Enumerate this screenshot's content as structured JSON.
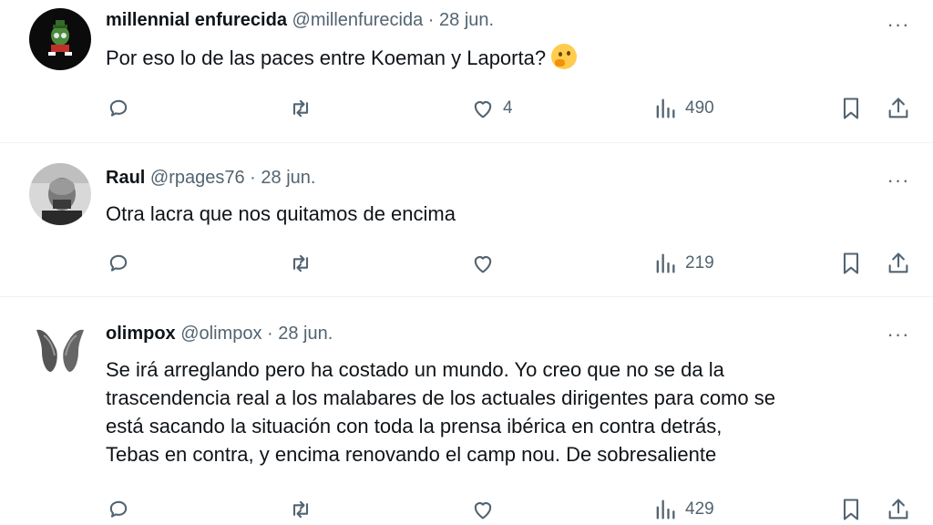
{
  "tweets": [
    {
      "name": "millennial enfurecida",
      "handle": "@millenfurecida",
      "separator": "·",
      "date": "28 jun.",
      "text": "Por eso lo de las paces entre Koeman y Laporta?",
      "emoji": "thinking-face",
      "likes": "4",
      "views": "490"
    },
    {
      "name": "Raul",
      "handle": "@rpages76",
      "separator": "·",
      "date": "28 jun.",
      "text": "Otra lacra que nos quitamos de encima",
      "likes": "",
      "views": "219"
    },
    {
      "name": "olimpox",
      "handle": "@olimpox",
      "separator": "·",
      "date": "28 jun.",
      "text_lines": [
        "Se irá arreglando pero ha costado un mundo. Yo creo que no se da la",
        "trascendencia real a los malabares de los actuales dirigentes para como se",
        "está sacando la situación con toda la prensa ibérica en contra detrás,",
        "Tebas en contra, y encima renovando el camp nou. De sobresaliente"
      ],
      "likes": "",
      "views": "429"
    }
  ],
  "more_label": "···",
  "colors": {
    "text": "#0f1419",
    "muted": "#536471",
    "divider": "#eff3f4"
  }
}
